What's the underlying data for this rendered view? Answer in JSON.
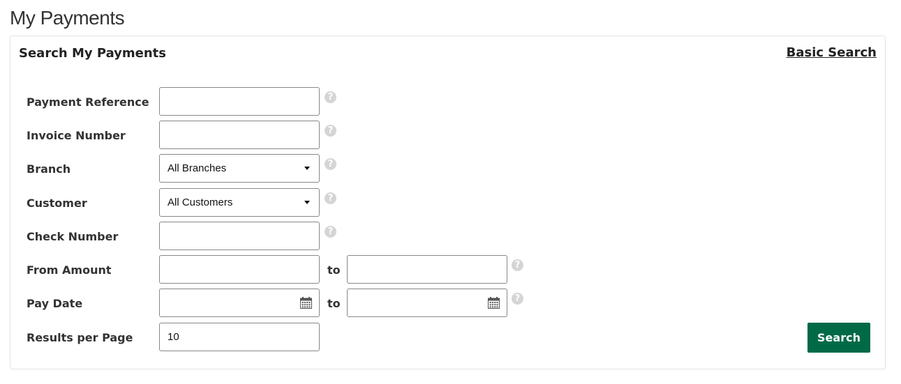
{
  "page": {
    "title": "My Payments"
  },
  "panel": {
    "title": "Search My Payments",
    "basic_search_link": "Basic Search"
  },
  "form": {
    "payment_reference": {
      "label": "Payment Reference",
      "value": "",
      "help_icon": "question-circle-icon"
    },
    "invoice_number": {
      "label": "Invoice Number",
      "value": "",
      "help_icon": "question-circle-icon"
    },
    "branch": {
      "label": "Branch",
      "selected": "All Branches",
      "help_icon": "question-circle-icon"
    },
    "customer": {
      "label": "Customer",
      "selected": "All Customers",
      "help_icon": "question-circle-icon"
    },
    "check_number": {
      "label": "Check Number",
      "value": "",
      "help_icon": "question-circle-icon"
    },
    "from_amount": {
      "label": "From Amount",
      "to_label": "to",
      "from_value": "",
      "to_value": "",
      "help_icon": "question-circle-icon"
    },
    "pay_date": {
      "label": "Pay Date",
      "to_label": "to",
      "from_value": "",
      "to_value": "",
      "calendar_icon": "calendar-icon",
      "help_icon": "question-circle-icon"
    },
    "results_per_page": {
      "label": "Results per Page",
      "value": "10"
    }
  },
  "actions": {
    "search_label": "Search"
  },
  "colors": {
    "primary_button": "#006a47",
    "help_icon": "#d5d5d5",
    "input_border": "#888888",
    "panel_border": "#e2e2e2"
  },
  "help_glyph": "?"
}
